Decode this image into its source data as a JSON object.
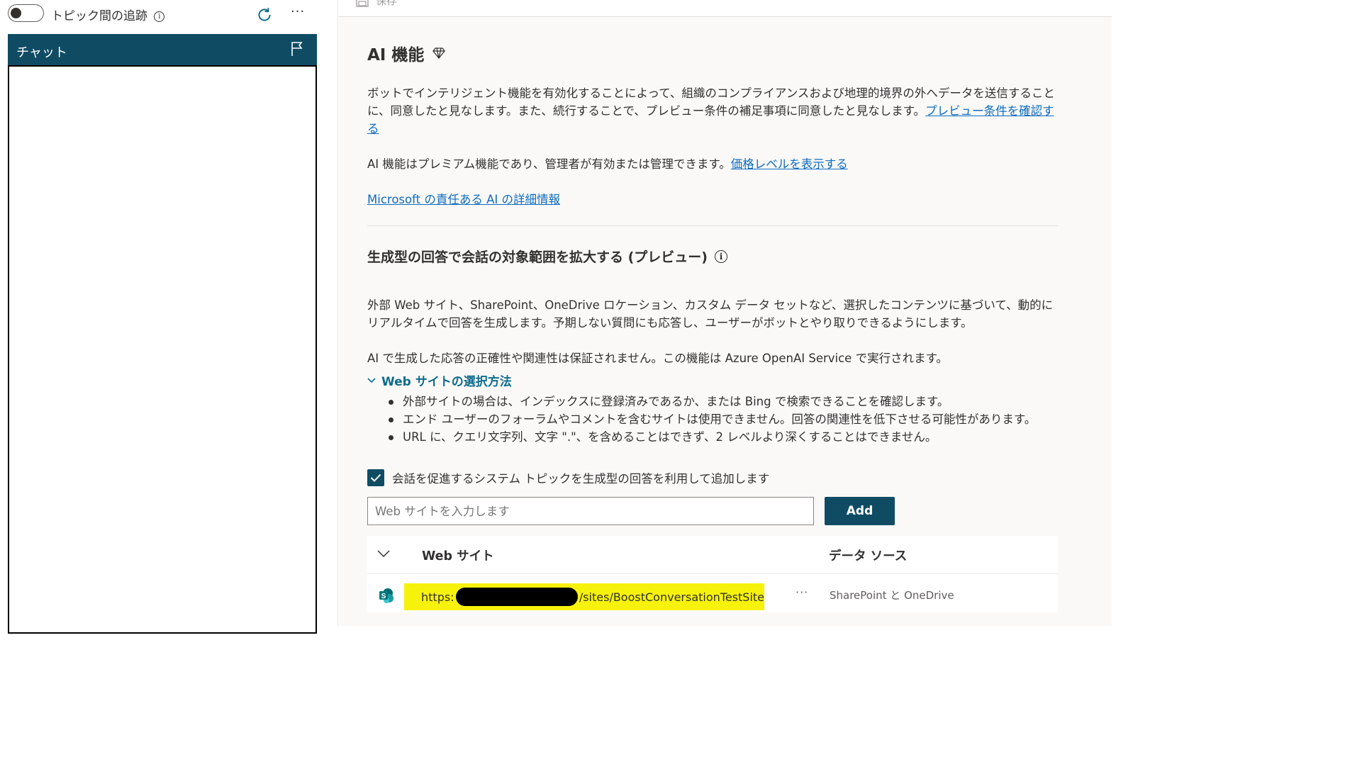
{
  "left_panel": {
    "tracking_label": "トピック間の追跡",
    "chat_title": "チャット"
  },
  "topbar": {
    "save_label": "保存"
  },
  "ai": {
    "title": "AI 機能",
    "para1": "ボットでインテリジェント機能を有効化することによって、組織のコンプライアンスおよび地理的境界の外へデータを送信することに、同意したと見なします。また、続行することで、プレビュー条件の補足事項に同意したと見なします。",
    "para1_link": "プレビュー条件を確認する",
    "para2": "AI 機能はプレミアム機能であり、管理者が有効または管理できます。",
    "para2_link": "価格レベルを表示する",
    "responsible_link": "Microsoft の責任ある AI の詳細情報"
  },
  "generative": {
    "title": "生成型の回答で会話の対象範囲を拡大する (プレビュー)",
    "para1": "外部 Web サイト、SharePoint、OneDrive ロケーション、カスタム データ セットなど、選択したコンテンツに基づいて、動的にリアルタイムで回答を生成します。予期しない質問にも応答し、ユーザーがボットとやり取りできるようにします。",
    "para2": "AI で生成した応答の正確性や関連性は保証されません。この機能は Azure OpenAI Service で実行されます。",
    "disclosure_label": "Web サイトの選択方法",
    "bullets": [
      "外部サイトの場合は、インデックスに登録済みであるか、または Bing で検索できることを確認します。",
      "エンド ユーザーのフォーラムやコメントを含むサイトは使用できません。回答の関連性を低下させる可能性があります。",
      "URL に、クエリ文字列、文字 \".\"、を含めることはできず、2 レベルより深くすることはできません。"
    ],
    "checkbox_label": "会話を促進するシステム トピックを生成型の回答を利用して追加します",
    "checkbox_checked": true,
    "input_placeholder": "Web サイトを入力します",
    "input_value": "",
    "add_label": "Add"
  },
  "table": {
    "col_website": "Web サイト",
    "col_source": "データ ソース",
    "rows": [
      {
        "url_prefix": "https:",
        "url_suffix": "/sites/BoostConversationTestSite",
        "source": "SharePoint と OneDrive"
      }
    ]
  },
  "colors": {
    "accent": "#0f4c64",
    "link": "#0f6cbd",
    "highlight": "#f7f20b"
  }
}
